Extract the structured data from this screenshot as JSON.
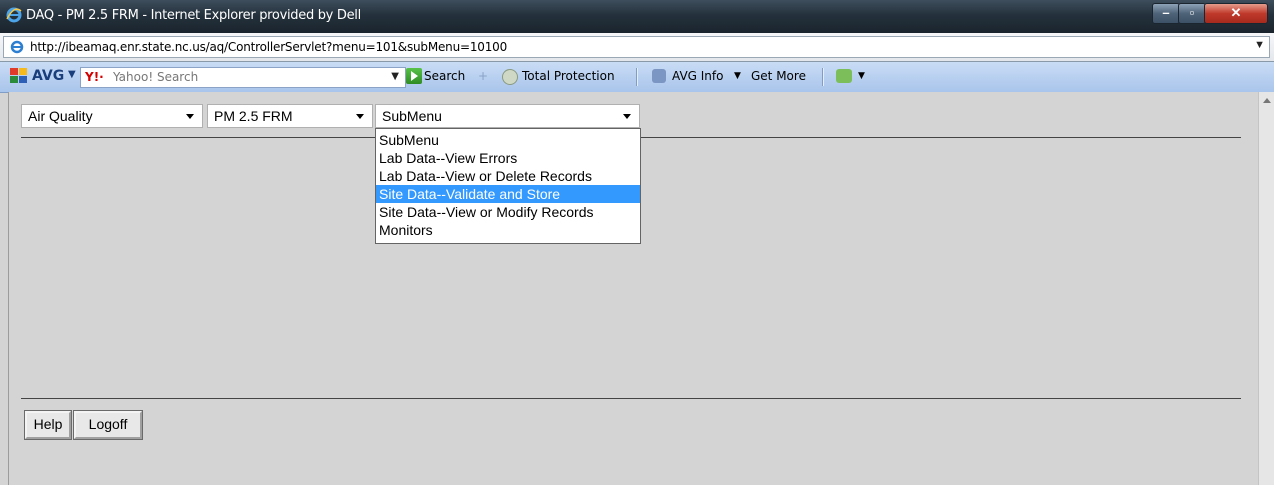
{
  "window": {
    "title": "DAQ - PM 2.5 FRM - Internet Explorer provided by Dell"
  },
  "address_bar": {
    "url": "http://ibeamaq.enr.state.nc.us/aq/ControllerServlet?menu=101&subMenu=10100"
  },
  "avg_toolbar": {
    "brand": "AVG",
    "search_placeholder": "Yahoo! Search",
    "search_button": "Search",
    "total_protection": "Total Protection",
    "avg_info": "AVG Info",
    "get_more": "Get More"
  },
  "page": {
    "menu_select": {
      "value": "Air Quality"
    },
    "program_select": {
      "value": "PM 2.5 FRM"
    },
    "submenu_select": {
      "value": "SubMenu",
      "options": [
        "SubMenu",
        "Lab Data--View Errors",
        "Lab Data--View or Delete Records",
        "Site Data--Validate and Store",
        "Site Data--View or Modify Records",
        "Monitors"
      ],
      "highlighted_option": "Site Data--Validate and Store"
    },
    "help_button": "Help",
    "logoff_button": "Logoff"
  },
  "colors": {
    "highlight": "#3399ff",
    "content_bg": "#d4d4d4"
  }
}
